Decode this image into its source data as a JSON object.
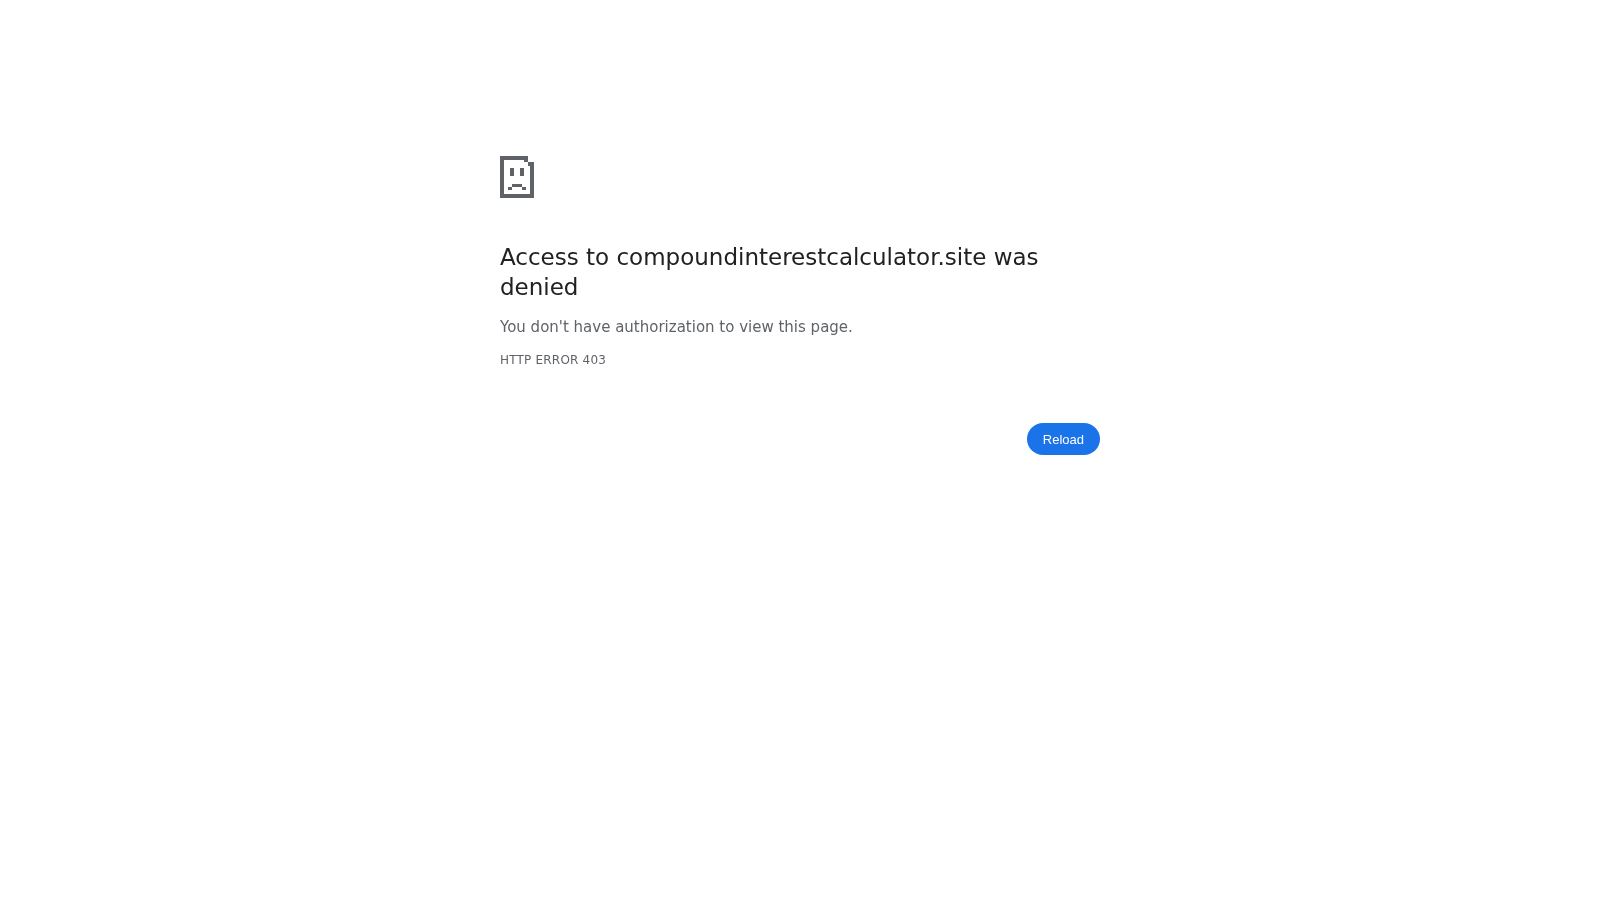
{
  "error_page": {
    "heading": "Access to compoundinterestcalculator.site was denied",
    "message": "You don't have authorization to view this page.",
    "error_code": "HTTP ERROR 403",
    "buttons": [
      "Reload"
    ]
  }
}
